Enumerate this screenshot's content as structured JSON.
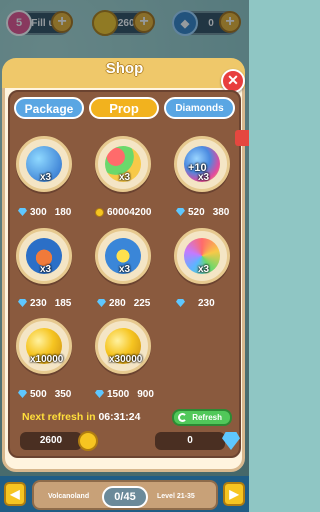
{
  "topbar": {
    "lives": {
      "count": "5",
      "label": "Fill up"
    },
    "coins": {
      "value": "2600"
    },
    "diamonds": {
      "value": "0"
    }
  },
  "modal": {
    "title": "Shop",
    "tabs": [
      {
        "label": "Package",
        "active": false
      },
      {
        "label": "Prop",
        "active": true
      },
      {
        "label": "Diamonds",
        "active": false
      }
    ],
    "items": [
      {
        "name": "Ball bomb",
        "qty": "x3",
        "currency": "diamond",
        "prices": [
          "300",
          "180"
        ]
      },
      {
        "name": "Color balls",
        "qty": "x3",
        "currency": "coin",
        "prices": [
          "6000",
          "4200"
        ]
      },
      {
        "name": "Plus ten balls",
        "qty": "x3",
        "badge": "+10",
        "currency": "diamond",
        "prices": [
          "520",
          "380"
        ]
      },
      {
        "name": "Bomb jar",
        "qty": "x3",
        "currency": "diamond",
        "prices": [
          "230",
          "185"
        ]
      },
      {
        "name": "Star bomb",
        "qty": "x3",
        "currency": "diamond",
        "prices": [
          "280",
          "225"
        ]
      },
      {
        "name": "Rainbow ball",
        "qty": "x3",
        "currency": "diamond",
        "prices": [
          "230"
        ]
      },
      {
        "name": "Coin pile small",
        "qty": "x10000",
        "currency": "diamond",
        "prices": [
          "500",
          "350"
        ]
      },
      {
        "name": "Coin pile large",
        "qty": "x30000",
        "currency": "diamond",
        "prices": [
          "1500",
          "900"
        ]
      }
    ],
    "next_refresh_label": "Next refresh in",
    "next_refresh_time": "06:31:24",
    "refresh_button": "Refresh",
    "balance_coins": "2600",
    "balance_diamonds": "0"
  },
  "bottom": {
    "area": "Volcanoland",
    "progress": "0/45",
    "levels": "Level 21-35"
  },
  "colors": {
    "accent_gold": "#f2b21e",
    "tab_blue": "#5aa6e3",
    "panel_brown": "#8a5a3e",
    "refresh_green": "#51c85a"
  }
}
